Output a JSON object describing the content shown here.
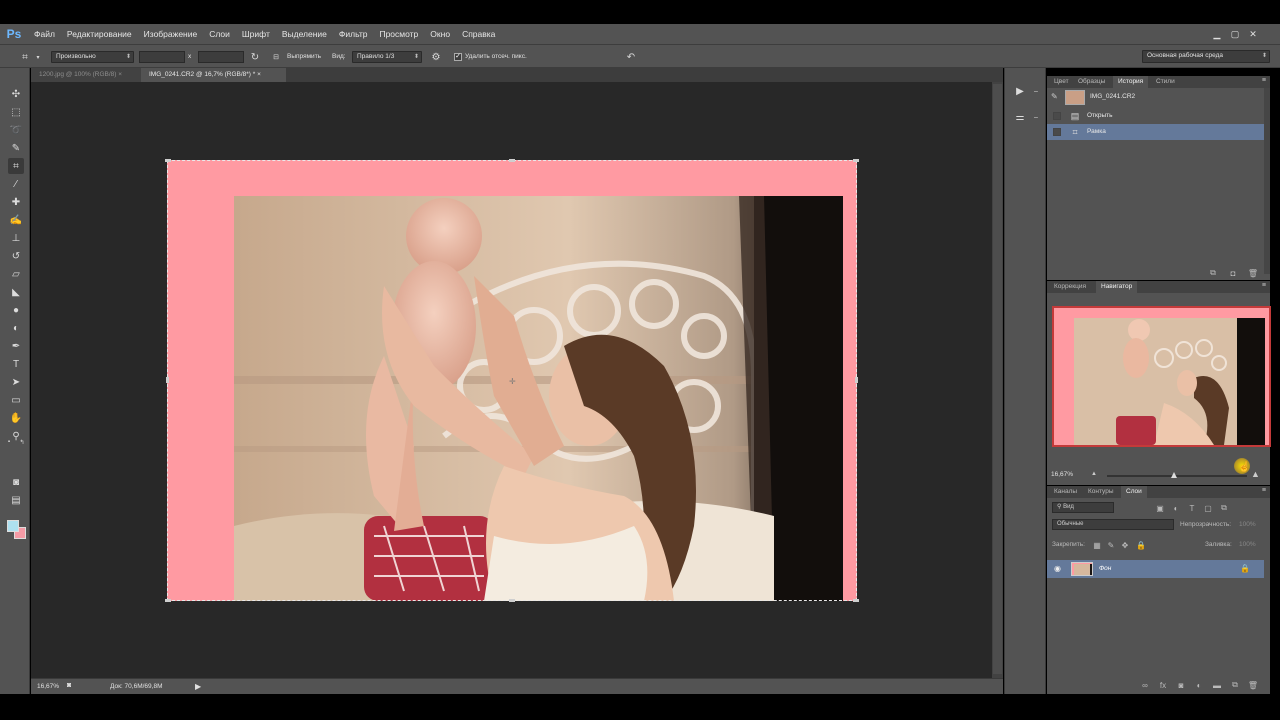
{
  "app": {
    "logo": "Ps",
    "menu": [
      "Файл",
      "Редактирование",
      "Изображение",
      "Слои",
      "Шрифт",
      "Выделение",
      "Фильтр",
      "Просмотр",
      "Окно",
      "Справка"
    ],
    "window_controls": [
      "minimize",
      "maximize",
      "close"
    ]
  },
  "options_bar": {
    "ratio_preset": "Произвольно",
    "ratio_x_separator": "x",
    "straighten_label": "Выпрямить",
    "view_label": "Вид:",
    "view_value": "Правило 1/3",
    "delete_cropped_label": "Удалить отсеч. пикс.",
    "delete_cropped_checked": true,
    "workspace": "Основная рабочая среда"
  },
  "tools": [
    "move-tool",
    "marquee-tool",
    "lasso-tool",
    "quick-select-tool",
    "crop-tool",
    "eyedropper-tool",
    "healing-brush-tool",
    "brush-tool",
    "clone-stamp-tool",
    "history-brush-tool",
    "eraser-tool",
    "gradient-tool",
    "blur-tool",
    "dodge-tool",
    "pen-tool",
    "type-tool",
    "path-select-tool",
    "shape-tool",
    "hand-tool",
    "zoom-tool"
  ],
  "colors": {
    "foreground": "#aee0f0",
    "background": "#f59ba6",
    "canvas_fill": "#ff9aa2",
    "selection": "#64799a"
  },
  "document_tabs": [
    {
      "label": "1200.jpg @ 100% (RGB/8) ×",
      "active": false
    },
    {
      "label": "IMG_0241.CR2 @ 16,7% (RGB/8*) * ×",
      "active": true
    }
  ],
  "status": {
    "zoom": "16,67%",
    "doc_size": "Док: 70,6M/69,8M"
  },
  "history_panel": {
    "tabs": [
      "Цвет",
      "Образцы",
      "История",
      "Стили"
    ],
    "active_tab": "История",
    "snapshot": "IMG_0241.CR2",
    "steps": [
      "Открыть",
      "Рамка"
    ],
    "selected_step": "Рамка"
  },
  "navigator_panel": {
    "tabs": [
      "Коррекция",
      "Навигатор"
    ],
    "active_tab": "Навигатор",
    "zoom": "16,67%"
  },
  "layers_panel": {
    "tabs": [
      "Каналы",
      "Контуры",
      "Слои"
    ],
    "active_tab": "Слои",
    "filter_kind": "Вид",
    "blend_mode": "Обычные",
    "opacity_label": "Непрозрачность:",
    "opacity_value": "100%",
    "lock_label": "Закрепить:",
    "fill_label": "Заливка:",
    "fill_value": "100%",
    "layers": [
      {
        "name": "Фон",
        "visible": true,
        "locked": true
      }
    ]
  }
}
